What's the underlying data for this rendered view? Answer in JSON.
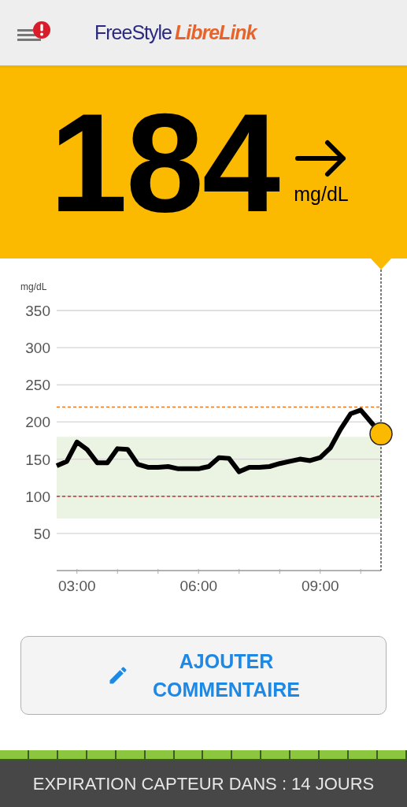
{
  "header": {
    "alert": true,
    "logo": {
      "brand": "FreeStyle",
      "product": "LibreLink"
    }
  },
  "reading": {
    "value": "184",
    "unit": "mg/dL",
    "arrow": {
      "kind": "right"
    }
  },
  "chart_data": {
    "type": "line",
    "ylabel": "mg/dL",
    "xlim": [
      2.5,
      10.5
    ],
    "ylim": [
      0,
      350
    ],
    "grid": true,
    "xticks": [
      {
        "value": 3,
        "label": "03:00"
      },
      {
        "value": 6,
        "label": "06:00"
      },
      {
        "value": 9,
        "label": "09:00"
      }
    ],
    "yticks": [
      50,
      100,
      150,
      200,
      250,
      300,
      350
    ],
    "x": [
      2.5,
      2.75,
      3,
      3.25,
      3.5,
      3.75,
      4,
      4.25,
      4.5,
      4.75,
      5,
      5.25,
      5.5,
      5.75,
      6,
      6.25,
      6.5,
      6.75,
      7,
      7.25,
      7.5,
      7.75,
      8,
      8.25,
      8.5,
      8.75,
      9,
      9.25,
      9.5,
      9.75,
      10,
      10.25,
      10.5
    ],
    "series": [
      {
        "color": "#000000",
        "values": [
          141,
          147,
          173,
          163,
          145,
          145,
          164,
          163,
          143,
          139,
          139,
          140,
          137,
          137,
          137,
          140,
          152,
          151,
          133,
          139,
          139,
          140,
          144,
          147,
          150,
          148,
          152,
          165,
          190,
          211,
          216,
          200,
          184
        ]
      }
    ],
    "bands": [
      {
        "axis": "y",
        "from": 70,
        "to": 180,
        "color": "#ebf3e2"
      }
    ],
    "ref_lines": [
      {
        "axis": "y",
        "value": 220,
        "color": "#e87722"
      },
      {
        "axis": "y",
        "value": 100,
        "color": "#e0262a"
      }
    ]
  },
  "comment_button": {
    "label_lines": [
      "AJOUTER",
      "COMMENTAIRE"
    ]
  },
  "sensor": {
    "level": 1,
    "text": "EXPIRATION CAPTEUR DANS : 14 JOURS"
  }
}
